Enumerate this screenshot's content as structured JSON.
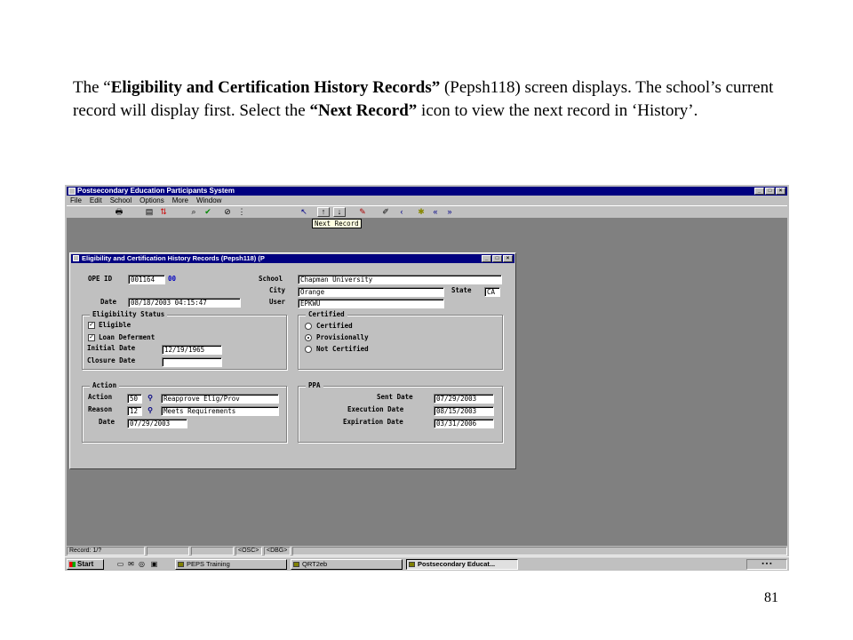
{
  "caption": {
    "p1": "The “",
    "b1": "Eligibility and Certification History Records”",
    "p2": " (Pepsh118) screen displays. The school’s current record will display first.  Select the ",
    "b2": "“Next Record”",
    "p3": " icon to view the next record in ‘History’."
  },
  "page_number": "81",
  "app": {
    "title": "Postsecondary Education Participants System",
    "menu": [
      "File",
      "Edit",
      "School",
      "Options",
      "More",
      "Window"
    ],
    "window_buttons": [
      "_",
      "□",
      "×"
    ],
    "tooltip": "Next Record"
  },
  "inner_window": {
    "title": "Eligibility and Certification History Records (Pepsh118) (P"
  },
  "form": {
    "ope_id_label": "OPE ID",
    "ope_id": "001164",
    "ope_id_suffix": "00",
    "date_label": "Date",
    "date": "08/18/2003 04:15:47",
    "school_label": "School",
    "school": "Chapman University",
    "city_label": "City",
    "city": "Orange",
    "state_label": "State",
    "state": "CA",
    "user_label": "User",
    "user": "EPKWU"
  },
  "eligibility": {
    "title": "Eligibility Status",
    "eligible_label": "Eligible",
    "eligible_checked": true,
    "loan_label": "Loan Deferment",
    "loan_checked": true,
    "initial_date_label": "Initial Date",
    "initial_date": "12/19/1965",
    "closure_date_label": "Closure Date",
    "closure_date": ""
  },
  "certified": {
    "title": "Certified",
    "options": [
      "Certified",
      "Provisionally",
      "Not Certified"
    ],
    "selected": "Provisionally"
  },
  "action": {
    "title": "Action",
    "action_label": "Action",
    "action_code": "50",
    "action_text": "Reapprove Elig/Prov",
    "reason_label": "Reason",
    "reason_code": "12",
    "reason_text": "Meets Requirements",
    "date_label": "Date",
    "date": "07/29/2003"
  },
  "ppa": {
    "title": "PPA",
    "sent_label": "Sent Date",
    "sent": "07/29/2003",
    "exec_label": "Execution Date",
    "exec": "08/15/2003",
    "exp_label": "Expiration Date",
    "exp": "03/31/2006"
  },
  "status": {
    "record": "Record: 1/?",
    "osc": "<OSC>",
    "dbg": "<DBG>"
  },
  "taskbar": {
    "start": "Start",
    "tasks": [
      "PEPS Training",
      "QRT2eb",
      "Postsecondary Educat..."
    ]
  }
}
